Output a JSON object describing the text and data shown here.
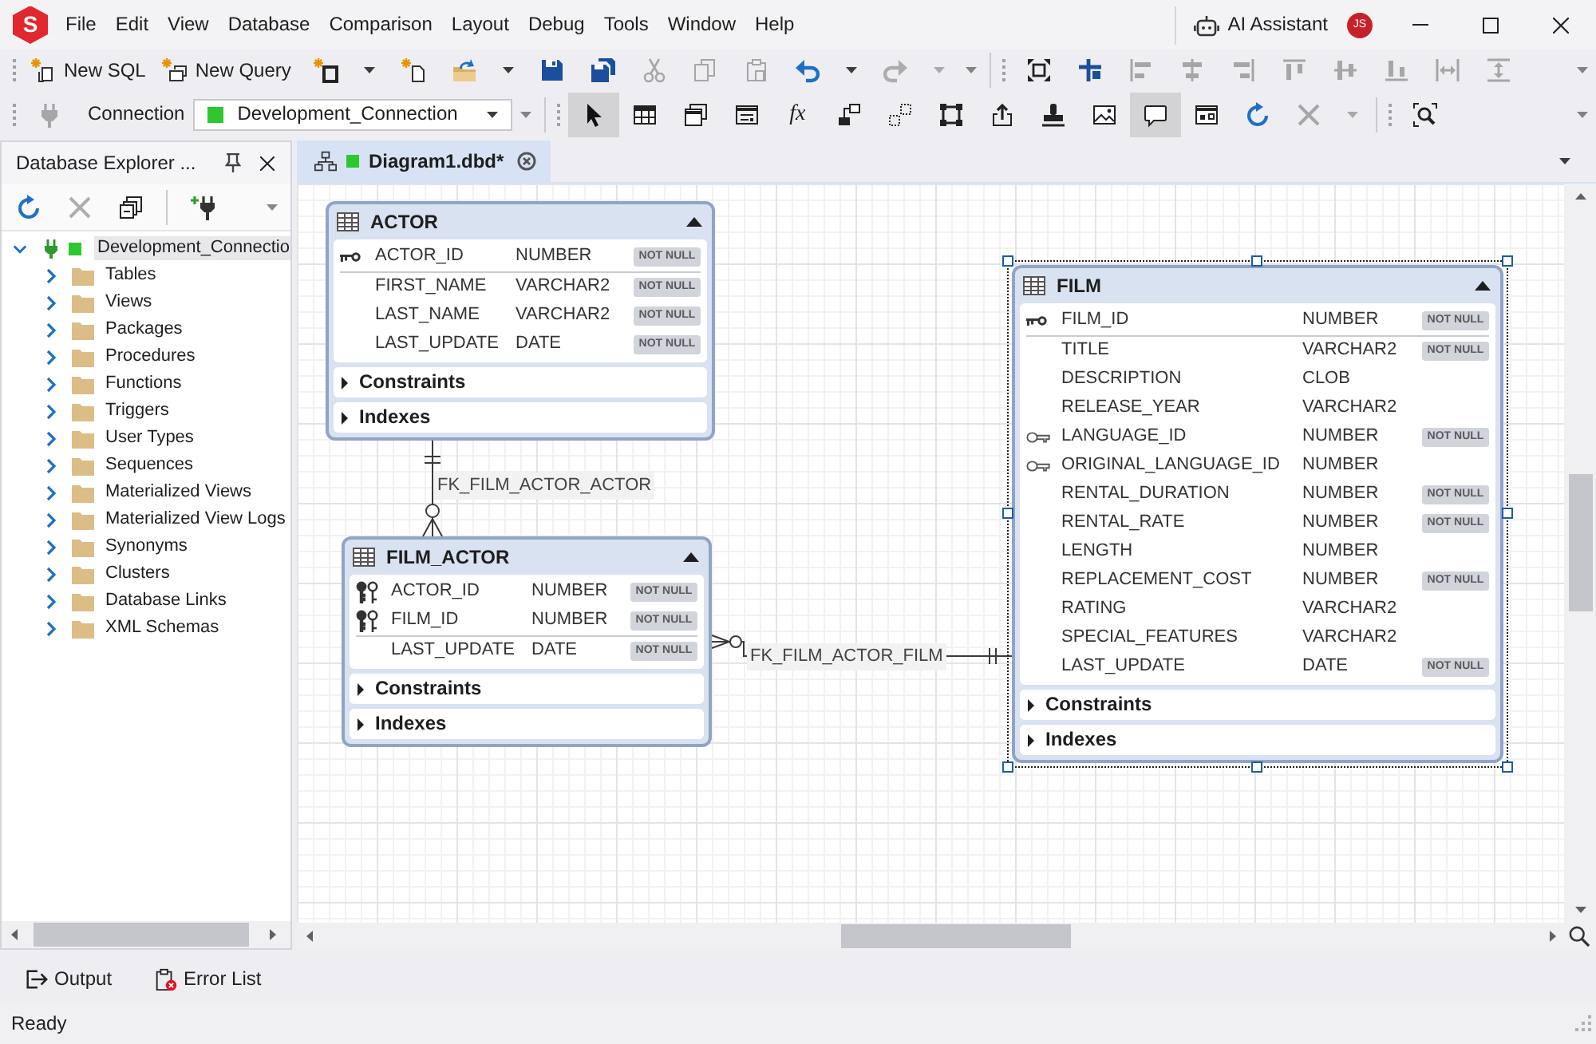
{
  "title_bar": {
    "logo": "S",
    "menu": [
      {
        "label": "File"
      },
      {
        "label": "Edit"
      },
      {
        "label": "View"
      },
      {
        "label": "Database"
      },
      {
        "label": "Comparison"
      },
      {
        "label": "Layout"
      },
      {
        "label": "Debug"
      },
      {
        "label": "Tools"
      },
      {
        "label": "Window"
      },
      {
        "label": "Help"
      }
    ],
    "assistant": "AI Assistant",
    "avatar": "JS"
  },
  "toolbars": [
    {
      "groups": [
        {
          "items": [
            {
              "kind": "button",
              "label": "New SQL",
              "disabled": false,
              "dropdown": false
            },
            {
              "kind": "button",
              "label": "New Query",
              "disabled": false,
              "dropdown": false
            },
            {
              "kind": "icon",
              "disabled": false,
              "dropdown": true
            },
            {
              "kind": "icon",
              "disabled": false,
              "dropdown": false
            },
            {
              "kind": "icon",
              "disabled": false,
              "dropdown": true
            },
            {
              "kind": "icon",
              "disabled": false,
              "dropdown": false
            },
            {
              "kind": "icon",
              "disabled": false,
              "dropdown": false
            },
            {
              "kind": "icon",
              "disabled": true,
              "dropdown": false
            },
            {
              "kind": "icon",
              "disabled": true,
              "dropdown": false
            },
            {
              "kind": "icon",
              "disabled": true,
              "dropdown": false
            },
            {
              "kind": "icon",
              "disabled": false,
              "dropdown": true
            },
            {
              "kind": "icon",
              "disabled": true,
              "dropdown": true
            }
          ]
        },
        {
          "items": [
            {
              "kind": "icon",
              "disabled": false,
              "dropdown": false
            },
            {
              "kind": "icon",
              "disabled": false,
              "dropdown": false
            },
            {
              "kind": "icon",
              "disabled": true,
              "dropdown": false
            },
            {
              "kind": "icon",
              "disabled": true,
              "dropdown": false
            },
            {
              "kind": "icon",
              "disabled": true,
              "dropdown": false
            },
            {
              "kind": "icon",
              "disabled": true,
              "dropdown": false
            },
            {
              "kind": "icon",
              "disabled": true,
              "dropdown": false
            },
            {
              "kind": "icon",
              "disabled": true,
              "dropdown": false
            },
            {
              "kind": "icon",
              "disabled": true,
              "dropdown": false
            },
            {
              "kind": "icon",
              "disabled": true,
              "dropdown": false
            }
          ]
        }
      ]
    },
    {
      "groups": [
        {
          "items": [
            {
              "kind": "icon",
              "disabled": true,
              "dropdown": false
            },
            {
              "kind": "label",
              "label": "Connection",
              "disabled": false,
              "dropdown": false
            },
            {
              "kind": "combo",
              "value": "Development_Connection",
              "disabled": false,
              "dropdown": false
            }
          ]
        },
        {
          "items": [
            {
              "kind": "icon",
              "selected": true,
              "disabled": false,
              "dropdown": false
            },
            {
              "kind": "icon",
              "selected": false,
              "disabled": false,
              "dropdown": false
            },
            {
              "kind": "icon",
              "selected": false,
              "disabled": false,
              "dropdown": false
            },
            {
              "kind": "icon",
              "selected": false,
              "disabled": false,
              "dropdown": false
            },
            {
              "kind": "glyph",
              "label": "fx",
              "selected": false,
              "disabled": false,
              "dropdown": false
            },
            {
              "kind": "icon",
              "selected": false,
              "disabled": false,
              "dropdown": false
            },
            {
              "kind": "icon",
              "selected": false,
              "disabled": false,
              "dropdown": false
            },
            {
              "kind": "icon",
              "selected": false,
              "disabled": false,
              "dropdown": false
            },
            {
              "kind": "icon",
              "selected": false,
              "disabled": false,
              "dropdown": false
            },
            {
              "kind": "icon",
              "selected": false,
              "disabled": false,
              "dropdown": false
            },
            {
              "kind": "icon",
              "selected": false,
              "disabled": false,
              "dropdown": false
            },
            {
              "kind": "icon",
              "selected": true,
              "disabled": false,
              "dropdown": false
            },
            {
              "kind": "icon",
              "selected": false,
              "disabled": false,
              "dropdown": false
            },
            {
              "kind": "icon",
              "selected": false,
              "disabled": false,
              "dropdown": false
            },
            {
              "kind": "icon",
              "selected": false,
              "disabled": true,
              "dropdown": true
            }
          ]
        },
        {
          "items": [
            {
              "kind": "icon",
              "disabled": false,
              "dropdown": false
            }
          ]
        }
      ]
    }
  ],
  "explorer": {
    "title": "Database Explorer ...",
    "toolbar": [
      {
        "items": [
          {
            "kind": "icon",
            "disabled": false
          },
          {
            "kind": "icon",
            "disabled": true
          },
          {
            "kind": "icon",
            "disabled": false
          }
        ]
      },
      {
        "items": [
          {
            "kind": "icon",
            "disabled": false
          }
        ]
      }
    ],
    "tree": [
      {
        "label": "Development_Connectio",
        "selected": true,
        "expanded": true,
        "children": [
          {
            "label": "Tables",
            "selected": false,
            "expanded": false
          },
          {
            "label": "Views",
            "selected": false,
            "expanded": false
          },
          {
            "label": "Packages",
            "selected": false,
            "expanded": false
          },
          {
            "label": "Procedures",
            "selected": false,
            "expanded": false
          },
          {
            "label": "Functions",
            "selected": false,
            "expanded": false
          },
          {
            "label": "Triggers",
            "selected": false,
            "expanded": false
          },
          {
            "label": "User Types",
            "selected": false,
            "expanded": false
          },
          {
            "label": "Sequences",
            "selected": false,
            "expanded": false
          },
          {
            "label": "Materialized Views",
            "selected": false,
            "expanded": false
          },
          {
            "label": "Materialized View Logs",
            "selected": false,
            "expanded": false
          },
          {
            "label": "Synonyms",
            "selected": false,
            "expanded": false
          },
          {
            "label": "Clusters",
            "selected": false,
            "expanded": false
          },
          {
            "label": "Database Links",
            "selected": false,
            "expanded": false
          },
          {
            "label": "XML Schemas",
            "selected": false,
            "expanded": false
          }
        ]
      }
    ]
  },
  "documents": {
    "tabs": [
      {
        "label": "Diagram1.dbd*",
        "selected": true
      }
    ]
  },
  "diagram": {
    "entities": [
      {
        "name": "ACTOR",
        "selected": false,
        "expanded": true,
        "columns": [
          {
            "name": "ACTOR_ID",
            "type": "NUMBER",
            "null_badge": "NOT NULL",
            "kind": "primary"
          },
          {
            "name": "FIRST_NAME",
            "type": "VARCHAR2",
            "null_badge": "NOT NULL",
            "kind": "plain"
          },
          {
            "name": "LAST_NAME",
            "type": "VARCHAR2",
            "null_badge": "NOT NULL",
            "kind": "plain"
          },
          {
            "name": "LAST_UPDATE",
            "type": "DATE",
            "null_badge": "NOT NULL",
            "kind": "plain"
          }
        ],
        "sections": [
          {
            "label": "Constraints",
            "expanded": false
          },
          {
            "label": "Indexes",
            "expanded": false
          }
        ]
      },
      {
        "name": "FILM_ACTOR",
        "selected": false,
        "expanded": true,
        "columns": [
          {
            "name": "ACTOR_ID",
            "type": "NUMBER",
            "null_badge": "NOT NULL",
            "kind": "both"
          },
          {
            "name": "FILM_ID",
            "type": "NUMBER",
            "null_badge": "NOT NULL",
            "kind": "both"
          },
          {
            "name": "LAST_UPDATE",
            "type": "DATE",
            "null_badge": "NOT NULL",
            "kind": "plain"
          }
        ],
        "sections": [
          {
            "label": "Constraints",
            "expanded": false
          },
          {
            "label": "Indexes",
            "expanded": false
          }
        ]
      },
      {
        "name": "FILM",
        "selected": true,
        "expanded": true,
        "columns": [
          {
            "name": "FILM_ID",
            "type": "NUMBER",
            "null_badge": "NOT NULL",
            "kind": "primary"
          },
          {
            "name": "TITLE",
            "type": "VARCHAR2",
            "null_badge": "NOT NULL",
            "kind": "plain"
          },
          {
            "name": "DESCRIPTION",
            "type": "CLOB",
            "kind": "plain"
          },
          {
            "name": "RELEASE_YEAR",
            "type": "VARCHAR2",
            "kind": "plain"
          },
          {
            "name": "LANGUAGE_ID",
            "type": "NUMBER",
            "null_badge": "NOT NULL",
            "kind": "foreign"
          },
          {
            "name": "ORIGINAL_LANGUAGE_ID",
            "type": "NUMBER",
            "kind": "foreign"
          },
          {
            "name": "RENTAL_DURATION",
            "type": "NUMBER",
            "null_badge": "NOT NULL",
            "kind": "plain"
          },
          {
            "name": "RENTAL_RATE",
            "type": "NUMBER",
            "null_badge": "NOT NULL",
            "kind": "plain"
          },
          {
            "name": "LENGTH",
            "type": "NUMBER",
            "kind": "plain"
          },
          {
            "name": "REPLACEMENT_COST",
            "type": "NUMBER",
            "null_badge": "NOT NULL",
            "kind": "plain"
          },
          {
            "name": "RATING",
            "type": "VARCHAR2",
            "kind": "plain"
          },
          {
            "name": "SPECIAL_FEATURES",
            "type": "VARCHAR2",
            "kind": "plain"
          },
          {
            "name": "LAST_UPDATE",
            "type": "DATE",
            "null_badge": "NOT NULL",
            "kind": "plain"
          }
        ],
        "sections": [
          {
            "label": "Constraints",
            "expanded": false
          },
          {
            "label": "Indexes",
            "expanded": false
          }
        ]
      }
    ],
    "relations": [
      {
        "label": "FK_FILM_ACTOR_ACTOR"
      },
      {
        "label": "FK_FILM_ACTOR_FILM"
      }
    ]
  },
  "bottom_tabs": [
    {
      "label": "Output"
    },
    {
      "label": "Error List"
    }
  ],
  "status_bar": {
    "text": "Ready"
  }
}
